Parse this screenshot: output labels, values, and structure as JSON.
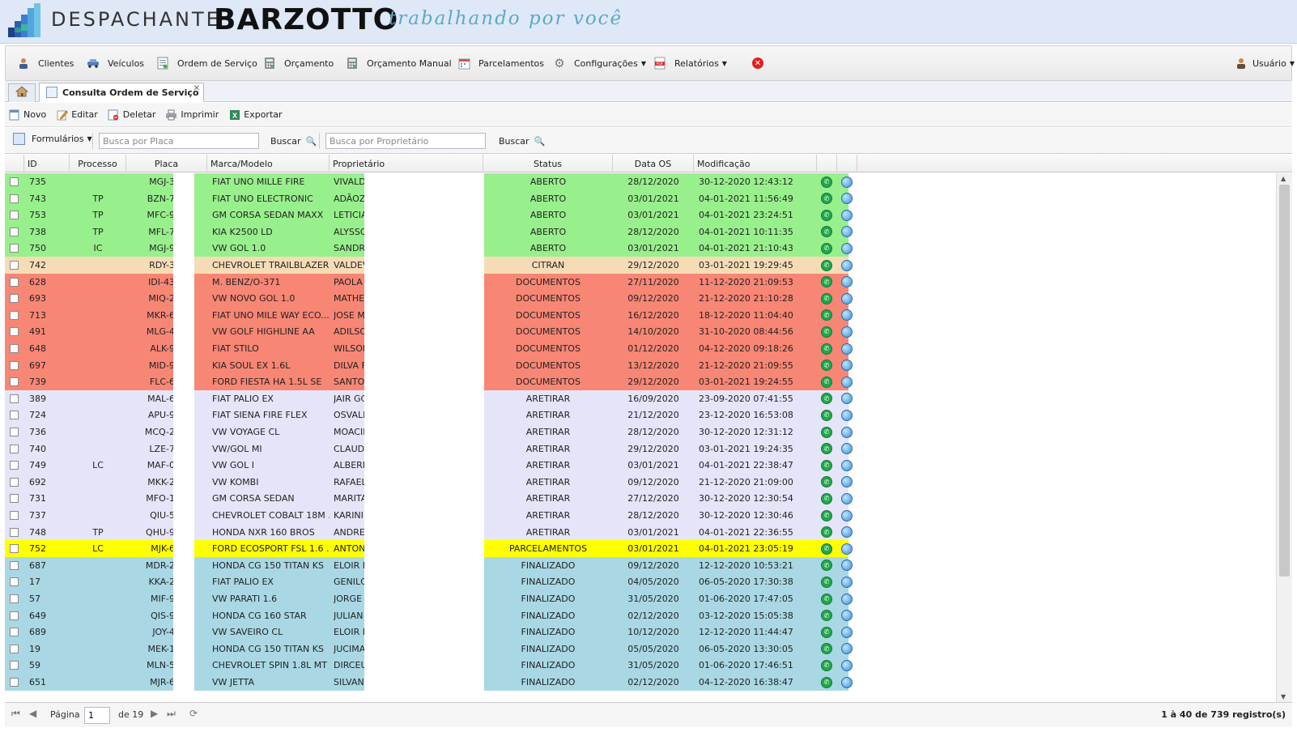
{
  "header": {
    "brand_prefix": "DESPACHANTE",
    "brand_name": "BARZOTTO",
    "slogan": "trabalhando por você"
  },
  "menu": {
    "items": [
      {
        "label": "Clientes",
        "icon": "user-icon"
      },
      {
        "label": "Veículos",
        "icon": "car-icon"
      },
      {
        "label": "Ordem de Serviço",
        "icon": "document-icon"
      },
      {
        "label": "Orçamento",
        "icon": "calculator-icon"
      },
      {
        "label": "Orçamento Manual",
        "icon": "calculator-icon"
      },
      {
        "label": "Parcelamentos",
        "icon": "calendar-icon"
      },
      {
        "label": "Configurações",
        "icon": "gear-icon"
      },
      {
        "label": "Relatórios",
        "icon": "pdf-icon"
      }
    ],
    "user_label": "Usuário"
  },
  "tabs": {
    "active_label": "Consulta Ordem de Serviço"
  },
  "toolbar": {
    "new_label": "Novo",
    "edit_label": "Editar",
    "delete_label": "Deletar",
    "print_label": "Imprimir",
    "export_label": "Exportar"
  },
  "search": {
    "forms_label": "Formulários",
    "plate_placeholder": "Busca por Placa",
    "owner_placeholder": "Busca por Proprietário",
    "button_label": "Buscar"
  },
  "grid": {
    "columns": [
      "ID",
      "Processo",
      "Placa",
      "Marca/Modelo",
      "Proprietário",
      "Status",
      "Data OS",
      "Modificação"
    ],
    "status_colors": {
      "ABERTO": "#98f08c",
      "CITRAN": "#f6dcb6",
      "DOCUMENTOS": "#f88674",
      "ARETIRAR": "#e5e5f9",
      "PARCELAMENTOS": "#ffff00",
      "FINALIZADO": "#a9d8e4"
    },
    "rows": [
      {
        "id": "735",
        "processo": "",
        "placa": "MGJ-3",
        "modelo": "FIAT UNO MILLE FIRE",
        "proprietario": "VIVALDI",
        "status": "ABERTO",
        "data_os": "28/12/2020",
        "modificacao": "30-12-2020 12:43:12"
      },
      {
        "id": "743",
        "processo": "TP",
        "placa": "BZN-7",
        "modelo": "FIAT UNO ELECTRONIC",
        "proprietario": "ADÃOZI",
        "status": "ABERTO",
        "data_os": "03/01/2021",
        "modificacao": "04-01-2021 11:56:49"
      },
      {
        "id": "753",
        "processo": "TP",
        "placa": "MFC-9",
        "modelo": "GM CORSA SEDAN MAXX",
        "proprietario": "LETICIA",
        "status": "ABERTO",
        "data_os": "03/01/2021",
        "modificacao": "04-01-2021 23:24:51"
      },
      {
        "id": "738",
        "processo": "TP",
        "placa": "MFL-7",
        "modelo": "KIA K2500 LD",
        "proprietario": "ALYSSO",
        "status": "ABERTO",
        "data_os": "28/12/2020",
        "modificacao": "04-01-2021 10:11:35"
      },
      {
        "id": "750",
        "processo": "IC",
        "placa": "MGJ-9",
        "modelo": "VW GOL 1.0",
        "proprietario": "SANDRA",
        "status": "ABERTO",
        "data_os": "03/01/2021",
        "modificacao": "04-01-2021 21:10:43"
      },
      {
        "id": "742",
        "processo": "",
        "placa": "RDY-3",
        "modelo": "CHEVROLET TRAILBLAZER...",
        "proprietario": "VALDEV",
        "status": "CITRAN",
        "data_os": "29/12/2020",
        "modificacao": "03-01-2021 19:29:45"
      },
      {
        "id": "628",
        "processo": "",
        "placa": "IDI-43",
        "modelo": "M. BENZ/O-371",
        "proprietario": "PAOLA I",
        "status": "DOCUMENTOS",
        "data_os": "27/11/2020",
        "modificacao": "11-12-2020 21:09:53"
      },
      {
        "id": "693",
        "processo": "",
        "placa": "MIQ-2",
        "modelo": "VW NOVO GOL 1.0",
        "proprietario": "MATHEU",
        "status": "DOCUMENTOS",
        "data_os": "09/12/2020",
        "modificacao": "21-12-2020 21:10:28"
      },
      {
        "id": "713",
        "processo": "",
        "placa": "MKR-6",
        "modelo": "FIAT UNO MILE WAY ECO...",
        "proprietario": "JOSE M",
        "status": "DOCUMENTOS",
        "data_os": "16/12/2020",
        "modificacao": "18-12-2020 11:04:40"
      },
      {
        "id": "491",
        "processo": "",
        "placa": "MLG-4",
        "modelo": "VW GOLF HIGHLINE AA",
        "proprietario": "ADILSO",
        "status": "DOCUMENTOS",
        "data_os": "14/10/2020",
        "modificacao": "31-10-2020 08:44:56"
      },
      {
        "id": "648",
        "processo": "",
        "placa": "ALK-9",
        "modelo": "FIAT STILO",
        "proprietario": "WILSON",
        "status": "DOCUMENTOS",
        "data_os": "01/12/2020",
        "modificacao": "04-12-2020 09:18:26"
      },
      {
        "id": "697",
        "processo": "",
        "placa": "MID-9",
        "modelo": "KIA SOUL EX 1.6L",
        "proprietario": "DILVA F",
        "status": "DOCUMENTOS",
        "data_os": "13/12/2020",
        "modificacao": "21-12-2020 21:09:55"
      },
      {
        "id": "739",
        "processo": "",
        "placa": "FLC-6",
        "modelo": "FORD FIESTA HA 1.5L SE",
        "proprietario": "SANTOL",
        "status": "DOCUMENTOS",
        "data_os": "29/12/2020",
        "modificacao": "03-01-2021 19:24:55"
      },
      {
        "id": "389",
        "processo": "",
        "placa": "MAL-6",
        "modelo": "FIAT PALIO EX",
        "proprietario": "JAIR GC",
        "status": "ARETIRAR",
        "data_os": "16/09/2020",
        "modificacao": "23-09-2020 07:41:55"
      },
      {
        "id": "724",
        "processo": "",
        "placa": "APU-9",
        "modelo": "FIAT SIENA FIRE FLEX",
        "proprietario": "OSVALD",
        "status": "ARETIRAR",
        "data_os": "21/12/2020",
        "modificacao": "23-12-2020 16:53:08"
      },
      {
        "id": "736",
        "processo": "",
        "placa": "MCQ-2",
        "modelo": "VW VOYAGE CL",
        "proprietario": "MOACIR",
        "status": "ARETIRAR",
        "data_os": "28/12/2020",
        "modificacao": "30-12-2020 12:31:12"
      },
      {
        "id": "740",
        "processo": "",
        "placa": "LZE-7",
        "modelo": "VW/GOL MI",
        "proprietario": "CLAUDI",
        "status": "ARETIRAR",
        "data_os": "29/12/2020",
        "modificacao": "03-01-2021 19:24:35"
      },
      {
        "id": "749",
        "processo": "LC",
        "placa": "MAF-0",
        "modelo": "VW GOL I",
        "proprietario": "ALBERI",
        "status": "ARETIRAR",
        "data_os": "03/01/2021",
        "modificacao": "04-01-2021 22:38:47"
      },
      {
        "id": "692",
        "processo": "",
        "placa": "MKK-2",
        "modelo": "VW KOMBI",
        "proprietario": "RAFAEL",
        "status": "ARETIRAR",
        "data_os": "09/12/2020",
        "modificacao": "21-12-2020 21:09:00"
      },
      {
        "id": "731",
        "processo": "",
        "placa": "MFO-1",
        "modelo": "GM CORSA SEDAN",
        "proprietario": "MARITA",
        "status": "ARETIRAR",
        "data_os": "27/12/2020",
        "modificacao": "30-12-2020 12:30:54"
      },
      {
        "id": "737",
        "processo": "",
        "placa": "QIU-5",
        "modelo": "CHEVROLET COBALT 18M ...",
        "proprietario": "KARINI",
        "status": "ARETIRAR",
        "data_os": "28/12/2020",
        "modificacao": "30-12-2020 12:30:46"
      },
      {
        "id": "748",
        "processo": "TP",
        "placa": "QHU-9",
        "modelo": "HONDA NXR 160 BROS",
        "proprietario": "ANDREZ",
        "status": "ARETIRAR",
        "data_os": "03/01/2021",
        "modificacao": "04-01-2021 22:36:55"
      },
      {
        "id": "752",
        "processo": "LC",
        "placa": "MJK-6",
        "modelo": "FORD ECOSPORT FSL 1.6 ...",
        "proprietario": "ANTONI",
        "status": "PARCELAMENTOS",
        "data_os": "03/01/2021",
        "modificacao": "04-01-2021 23:05:19"
      },
      {
        "id": "687",
        "processo": "",
        "placa": "MDR-2",
        "modelo": "HONDA CG 150 TITAN KS",
        "proprietario": "ELOIR F",
        "status": "FINALIZADO",
        "data_os": "09/12/2020",
        "modificacao": "12-12-2020 10:53:21"
      },
      {
        "id": "17",
        "processo": "",
        "placa": "KKA-2",
        "modelo": "FIAT PALIO EX",
        "proprietario": "GENILCI",
        "status": "FINALIZADO",
        "data_os": "04/05/2020",
        "modificacao": "06-05-2020 17:30:38"
      },
      {
        "id": "57",
        "processo": "",
        "placa": "MIF-9",
        "modelo": "VW PARATI 1.6",
        "proprietario": "JORGE",
        "status": "FINALIZADO",
        "data_os": "31/05/2020",
        "modificacao": "01-06-2020 17:47:05"
      },
      {
        "id": "649",
        "processo": "",
        "placa": "QIS-9",
        "modelo": "HONDA CG 160 STAR",
        "proprietario": "JULIAN",
        "status": "FINALIZADO",
        "data_os": "02/12/2020",
        "modificacao": "03-12-2020 15:05:38"
      },
      {
        "id": "689",
        "processo": "",
        "placa": "JOY-4",
        "modelo": "VW SAVEIRO CL",
        "proprietario": "ELOIR F",
        "status": "FINALIZADO",
        "data_os": "10/12/2020",
        "modificacao": "12-12-2020 11:44:47"
      },
      {
        "id": "19",
        "processo": "",
        "placa": "MEK-1",
        "modelo": "HONDA CG 150 TITAN KS",
        "proprietario": "JUCIMA",
        "status": "FINALIZADO",
        "data_os": "05/05/2020",
        "modificacao": "06-05-2020 13:30:05"
      },
      {
        "id": "59",
        "processo": "",
        "placa": "MLN-5",
        "modelo": "CHEVROLET SPIN 1.8L MT ...",
        "proprietario": "DIRCEU",
        "status": "FINALIZADO",
        "data_os": "31/05/2020",
        "modificacao": "01-06-2020 17:46:51"
      },
      {
        "id": "651",
        "processo": "",
        "placa": "MJR-6",
        "modelo": "VW JETTA",
        "proprietario": "SILVAN",
        "status": "FINALIZADO",
        "data_os": "02/12/2020",
        "modificacao": "04-12-2020 16:38:47"
      }
    ]
  },
  "pager": {
    "page_label": "Página",
    "current_page": "1",
    "of_label": "de 19",
    "summary": "1 à 40 de 739 registro(s)"
  }
}
